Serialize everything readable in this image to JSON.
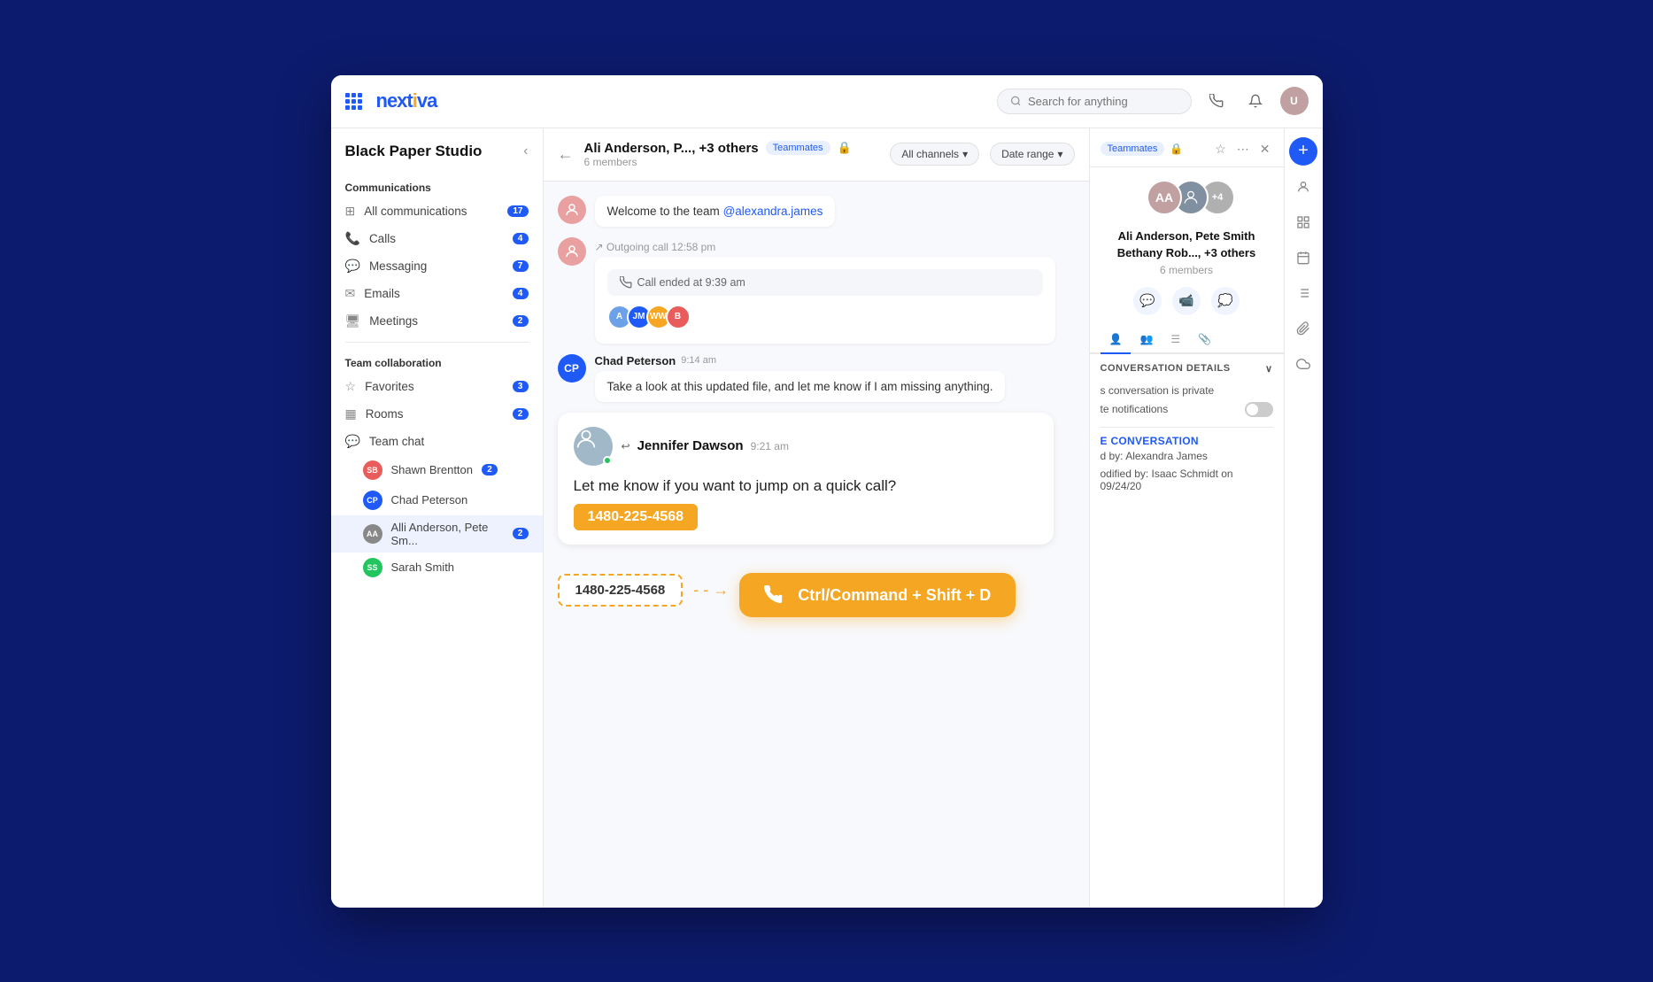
{
  "topbar": {
    "logo": "nextiva",
    "search_placeholder": "Search for anything"
  },
  "sidebar": {
    "workspace_name": "Black Paper Studio",
    "communications_label": "Communications",
    "items": [
      {
        "label": "All communications",
        "badge": "17"
      },
      {
        "label": "Calls",
        "badge": "4"
      },
      {
        "label": "Messaging",
        "badge": "7"
      },
      {
        "label": "Emails",
        "badge": "4"
      },
      {
        "label": "Meetings",
        "badge": "2"
      }
    ],
    "teamcol_label": "Team collaboration",
    "team_items": [
      {
        "label": "Favorites",
        "badge": "3"
      },
      {
        "label": "Rooms",
        "badge": "2"
      },
      {
        "label": "Team chat",
        "badge": ""
      }
    ],
    "chat_contacts": [
      {
        "name": "Shawn Brentton",
        "badge": "2",
        "color": "#e85c5c"
      },
      {
        "name": "Chad Peterson",
        "badge": "",
        "color": "#1f5af6"
      },
      {
        "name": "Alli Anderson, Pete Sm...",
        "badge": "2",
        "color": "#888",
        "active": true
      },
      {
        "name": "Sarah Smith",
        "badge": "",
        "color": "#22c55e"
      }
    ]
  },
  "chat_header": {
    "name": "Ali Anderson, P..., +3 others",
    "tag": "Teammates",
    "members": "6 members",
    "filter1": "All channels",
    "filter2": "Date range"
  },
  "messages": [
    {
      "sender": "",
      "time": "",
      "text": "Welcome to the team @alexandra.james",
      "type": "welcome"
    },
    {
      "type": "outgoing_call",
      "time": "12:58 pm",
      "call_ended": "Call ended  at 9:39 am"
    },
    {
      "sender": "Chad Peterson",
      "time": "9:14 am",
      "text": "Take a look at this updated file, and let me know if I am missing anything."
    },
    {
      "sender": "Jennifer Dawson",
      "time": "9:21 am",
      "text": "Let me know if you want to jump on a quick call?"
    }
  ],
  "featured_message": {
    "sender": "Jennifer Dawson",
    "time": "9:21 am",
    "text": "Let me know if you want to jump on a quick call?",
    "phone": "1480-225-4568"
  },
  "shortcut": {
    "label": "Ctrl/Command + Shift + D"
  },
  "right_panel": {
    "tag": "Teammates",
    "member_names": "Ali Anderson, Pete Smith\nBethany Rob..., +3 others",
    "member_count": "6 members",
    "conv_details_label": "CONVERSATION DETAILS",
    "private_label": "s conversation is private",
    "notifications_label": "te notifications",
    "section_label": "E CONVERSATION",
    "created_by": "d by: Alexandra James",
    "modified_by": "odified by: Isaac Schmidt on 09/24/20"
  }
}
